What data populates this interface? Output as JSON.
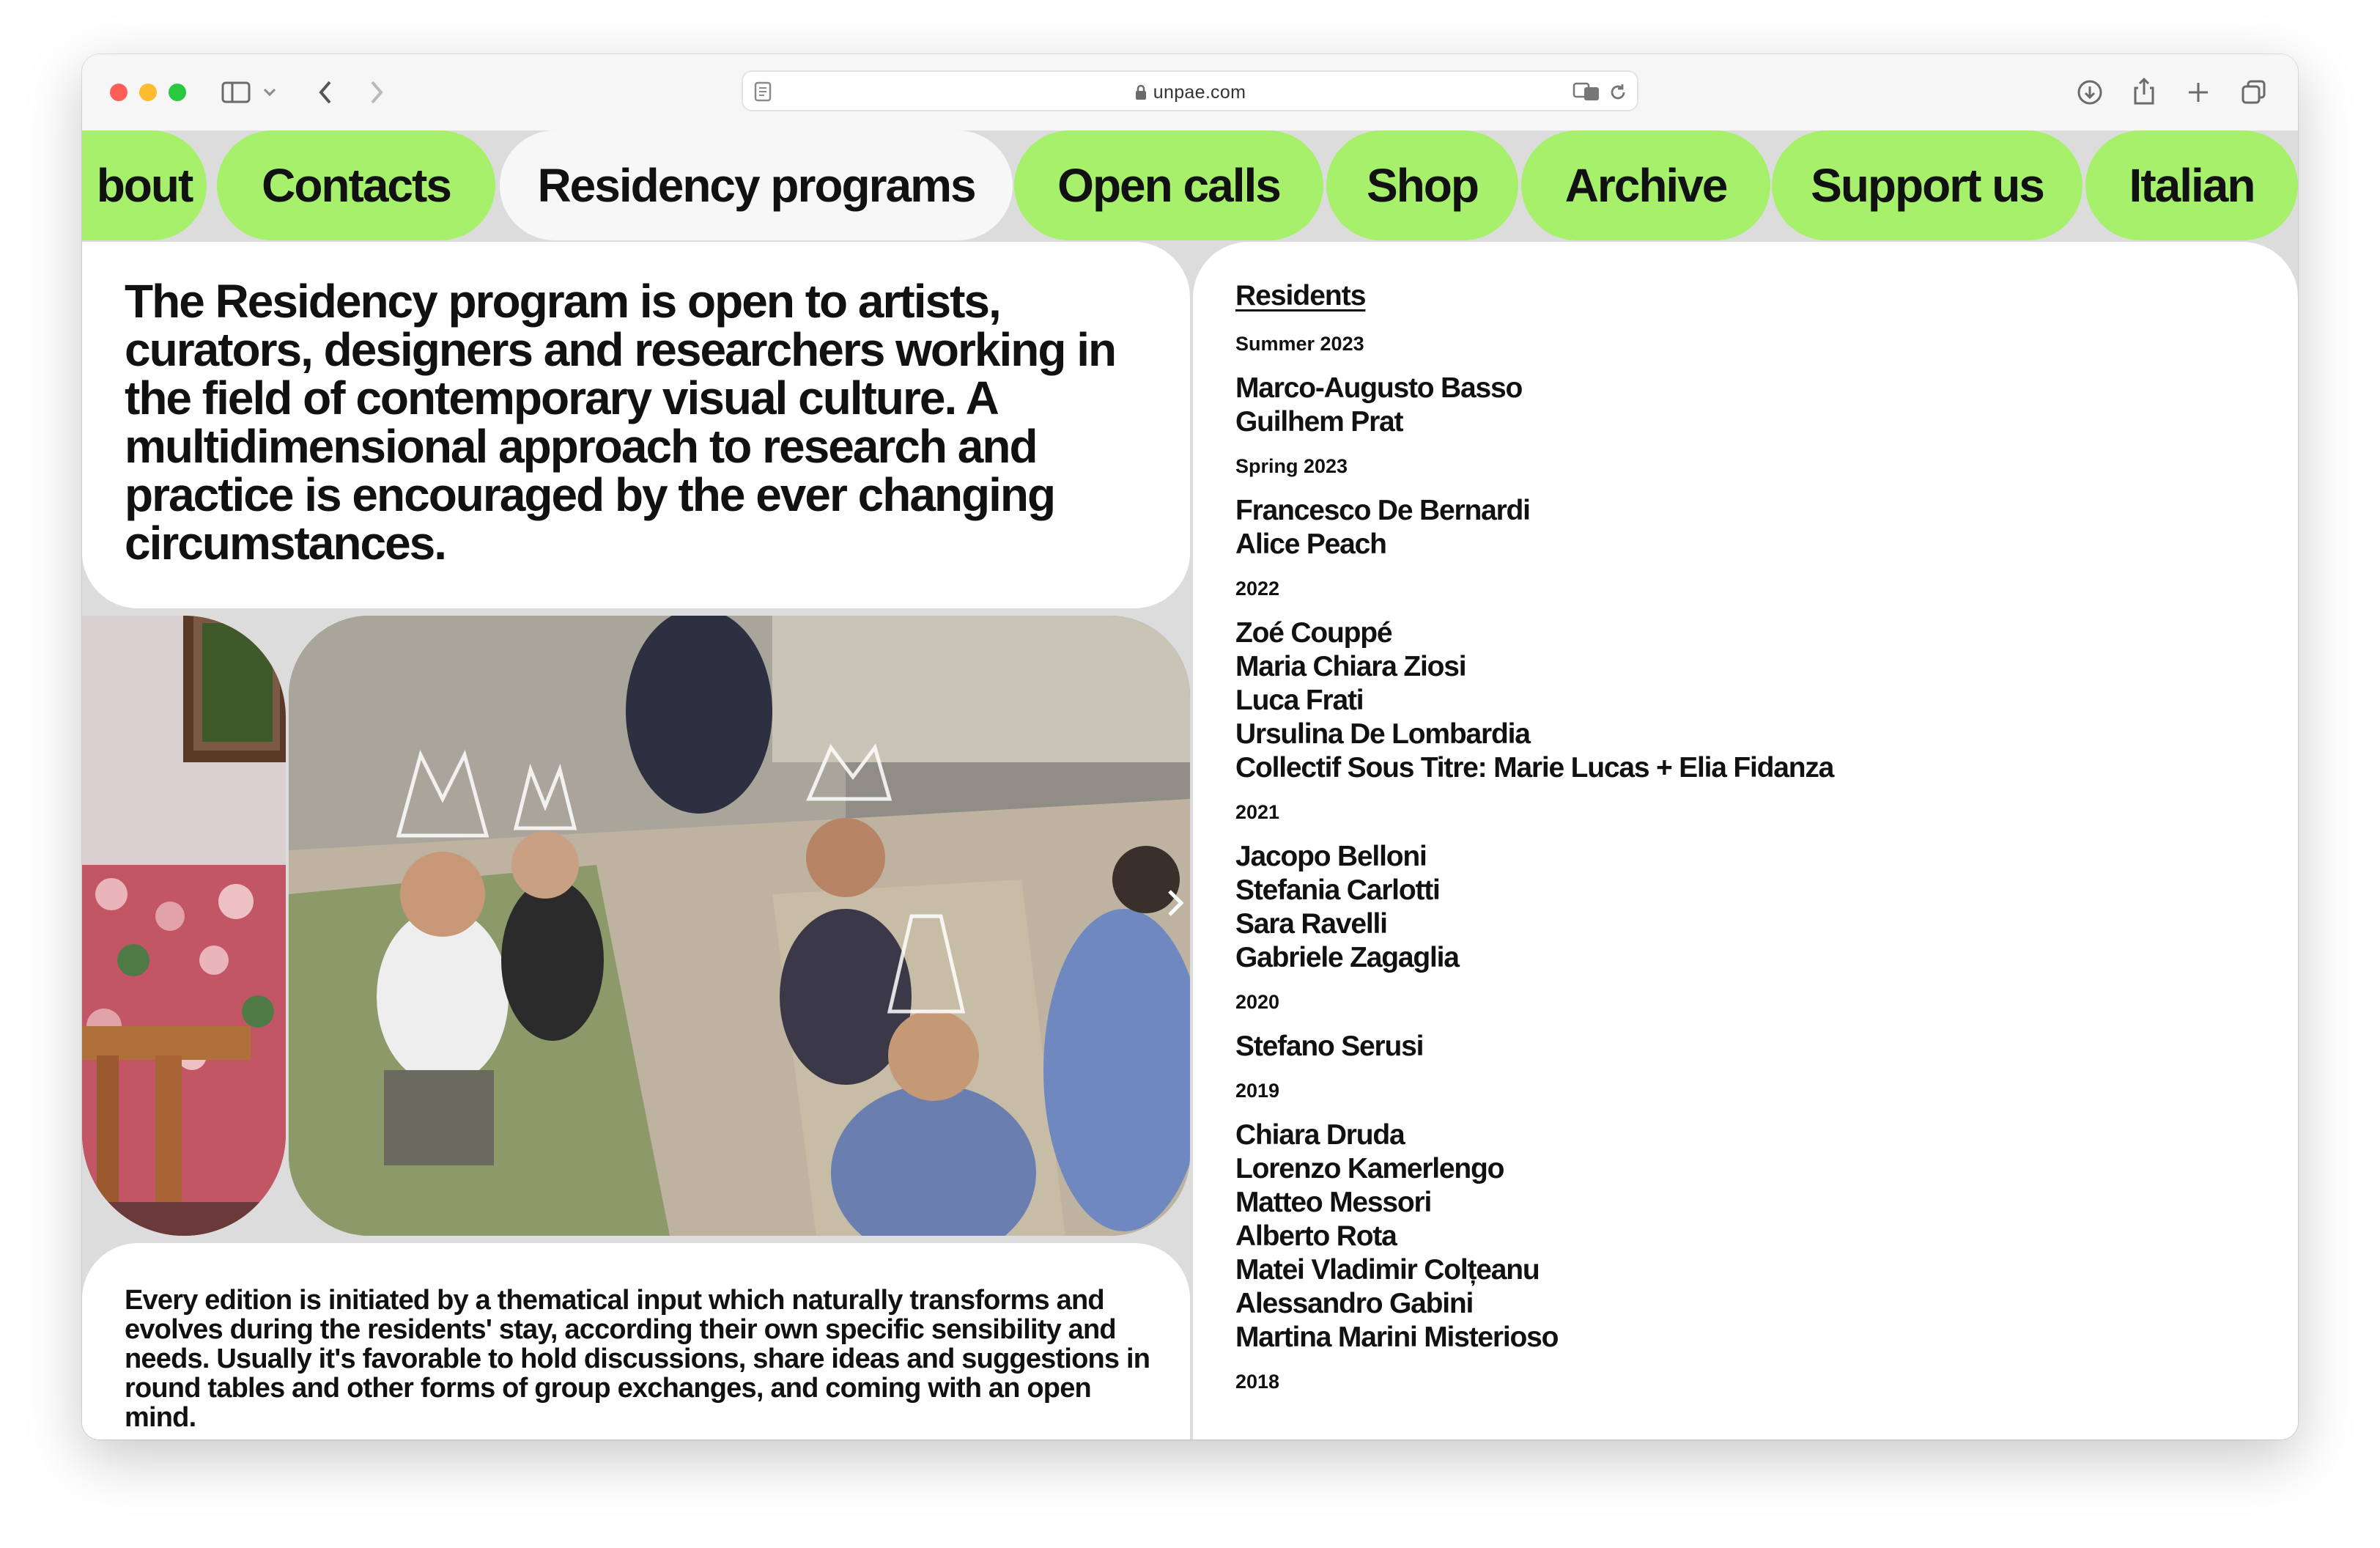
{
  "browser": {
    "url": "unpae.com",
    "icons": {
      "sidebar": "sidebar-icon",
      "chevron": "chevron-down-icon",
      "back": "back-arrow-icon",
      "forward": "forward-arrow-icon",
      "reader": "reader-icon",
      "lock": "lock-icon",
      "translate": "translate-icon",
      "reload": "reload-icon",
      "download": "download-icon",
      "share": "share-icon",
      "new_tab": "plus-icon",
      "tabs": "tabs-overview-icon"
    }
  },
  "nav": {
    "items": [
      "bout",
      "Contacts",
      "Residency programs",
      "Open calls",
      "Shop",
      "Archive",
      "Support us",
      "Italian"
    ],
    "active": "Residency programs",
    "accent": "#a6f06c"
  },
  "intro": {
    "text": "The Residency program is open to artists, curators, designers and researchers working in the field of contemporary visual culture. A multidimensional approach to research and practice is encouraged by the ever changing circumstances."
  },
  "body": {
    "text": "Every edition is initiated by a thematical input which naturally transforms and evolves during the residents' stay, according their own specific sensibility and needs. Usually it's favorable to hold discussions, share ideas and suggestions in round tables and other forms of group exchanges, and coming with an open mind."
  },
  "residents": {
    "heading": "Residents",
    "groups": [
      {
        "year": "Summer 2023",
        "names": [
          "Marco-Augusto Basso",
          "Guilhem Prat"
        ]
      },
      {
        "year": "Spring 2023",
        "names": [
          "Francesco De Bernardi",
          "Alice Peach"
        ]
      },
      {
        "year": "2022",
        "names": [
          "Zoé Couppé",
          "Maria Chiara Ziosi",
          "Luca Frati",
          "Ursulina De Lombardia",
          "Collectif Sous Titre: Marie Lucas + Elia Fidanza"
        ]
      },
      {
        "year": "2021",
        "names": [
          "Jacopo Belloni",
          "Stefania Carlotti",
          "Sara Ravelli",
          "Gabriele Zagaglia"
        ]
      },
      {
        "year": "2020",
        "names": [
          "Stefano Serusi"
        ]
      },
      {
        "year": "2019",
        "names": [
          "Chiara Druda",
          "Lorenzo Kamerlengo",
          "Matteo Messori",
          "Alberto Rota",
          "Matei Vladimir Colțeanu",
          "Alessandro Gabini",
          "Martina Marini Misterioso"
        ]
      },
      {
        "year": "2018",
        "names": []
      }
    ]
  }
}
